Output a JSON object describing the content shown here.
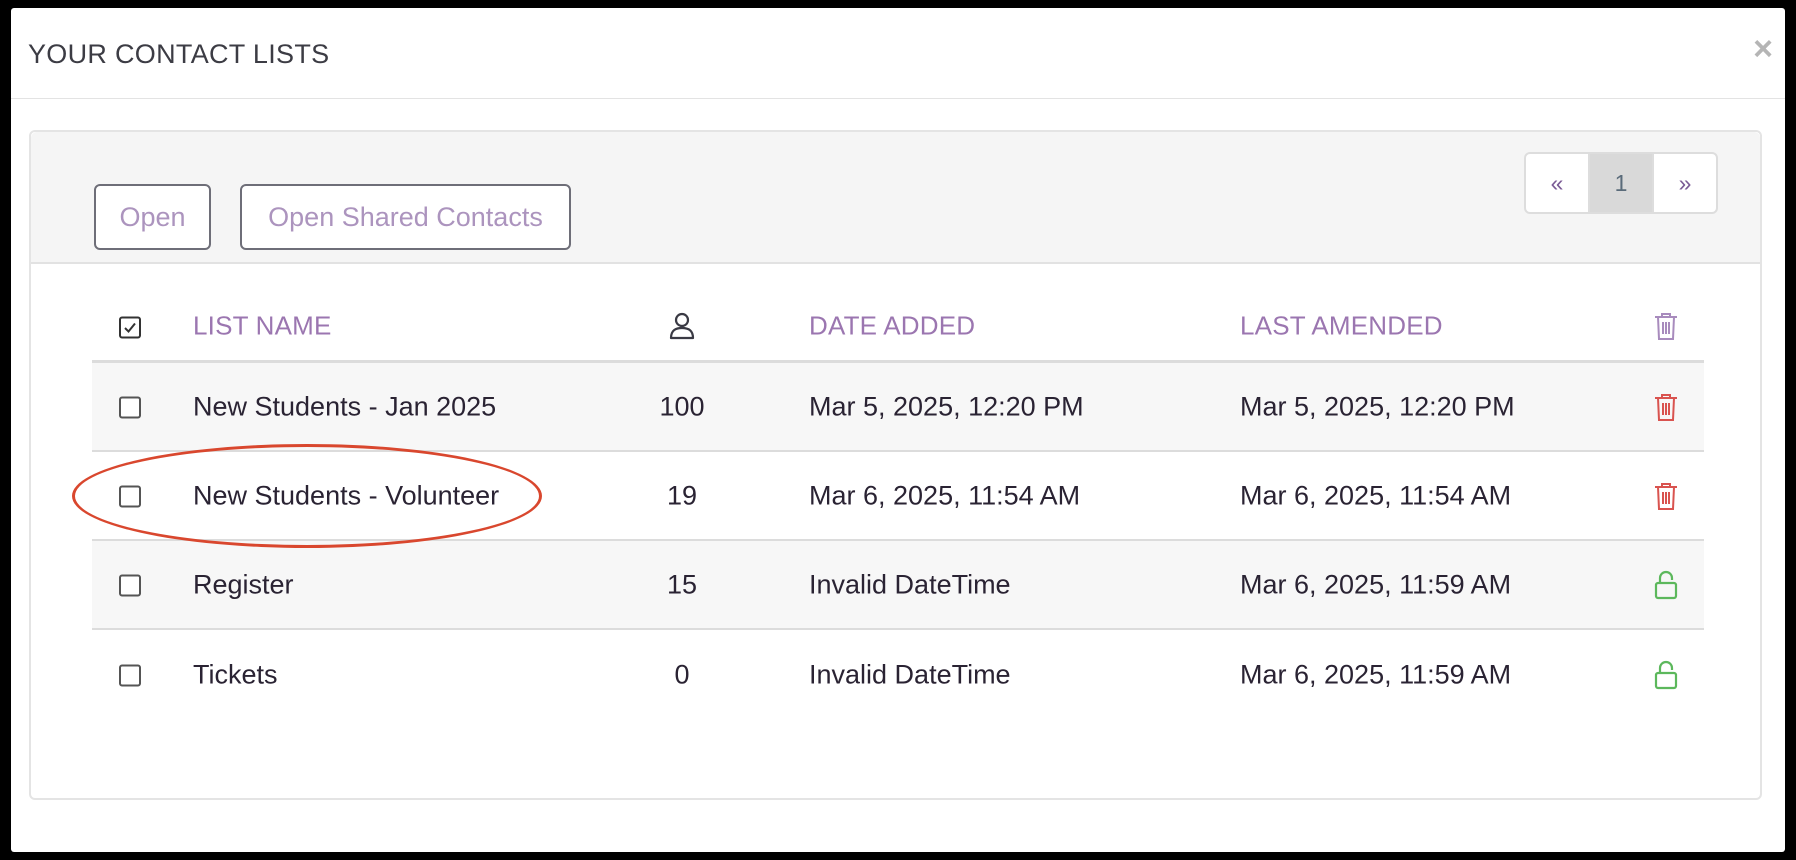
{
  "modal": {
    "title": "YOUR CONTACT LISTS",
    "close_label": "×"
  },
  "toolbar": {
    "open_label": "Open",
    "open_shared_label": "Open Shared Contacts"
  },
  "pagination": {
    "prev": "«",
    "current": "1",
    "next": "»"
  },
  "table": {
    "headers": {
      "name": "LIST NAME",
      "count_icon": "person-icon",
      "date_added": "DATE ADDED",
      "last_amended": "LAST AMENDED",
      "action_icon": "trash-icon"
    },
    "rows": [
      {
        "name": "New Students - Jan 2025",
        "count": "100",
        "date_added": "Mar 5, 2025, 12:20 PM",
        "last_amended": "Mar 5, 2025, 12:20 PM",
        "action_icon": "trash-icon",
        "checked": false
      },
      {
        "name": "New Students - Volunteer",
        "count": "19",
        "date_added": "Mar 6, 2025, 11:54 AM",
        "last_amended": "Mar 6, 2025, 11:54 AM",
        "action_icon": "trash-icon",
        "checked": false
      },
      {
        "name": "Register",
        "count": "15",
        "date_added": "Invalid DateTime",
        "last_amended": "Mar 6, 2025, 11:59 AM",
        "action_icon": "lock-icon",
        "checked": false
      },
      {
        "name": "Tickets",
        "count": "0",
        "date_added": "Invalid DateTime",
        "last_amended": "Mar 6, 2025, 11:59 AM",
        "action_icon": "lock-icon",
        "checked": false
      }
    ]
  },
  "colors": {
    "accent": "#9b76b0",
    "delete": "#d9534f",
    "locked": "#5cb85c",
    "annotation": "#d9472e"
  }
}
